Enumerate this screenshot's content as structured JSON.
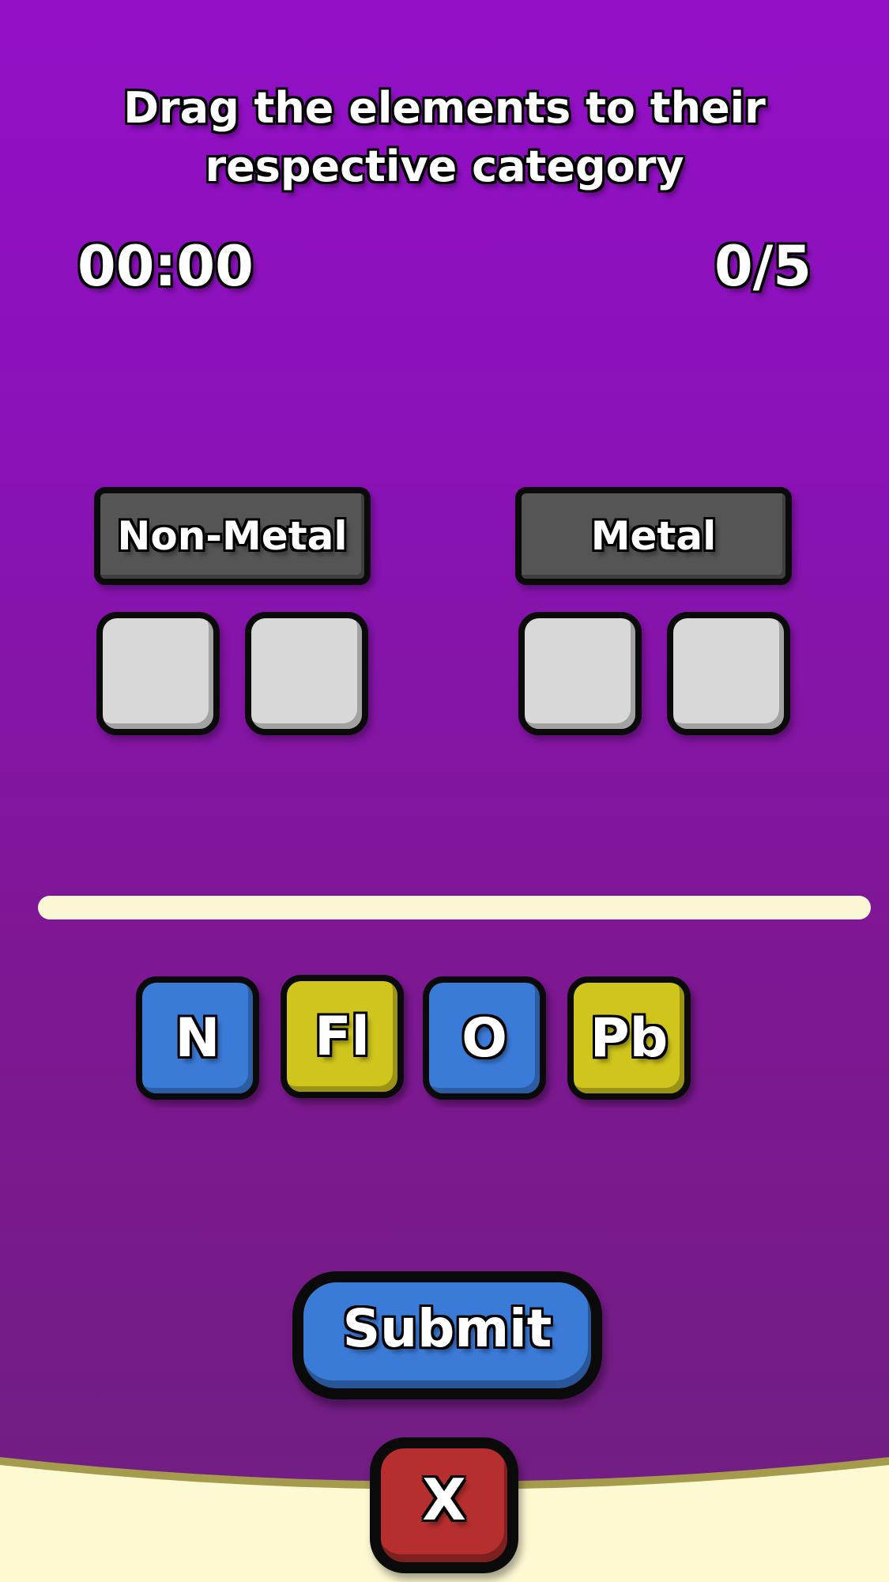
{
  "instructions": {
    "line1": "Drag the elements to their",
    "line2": "respective category"
  },
  "timer": "00:00",
  "score": "0/5",
  "categories": [
    {
      "label": "Non-Metal",
      "slots": 2
    },
    {
      "label": "Metal",
      "slots": 2
    }
  ],
  "element_tiles": [
    {
      "symbol": "N",
      "color": "#3b7bd8"
    },
    {
      "symbol": "Fl",
      "color": "#cfc51c"
    },
    {
      "symbol": "O",
      "color": "#3b7bd8"
    },
    {
      "symbol": "Pb",
      "color": "#cfc51c"
    }
  ],
  "submit_label": "Submit",
  "close_label": "X",
  "colors": {
    "background_top": "#920fc6",
    "background_bottom": "#701f80",
    "category_label_bg": "#555555",
    "slot_bg": "#d8d8d8",
    "divider": "#fbf6d4",
    "submit_bg": "#3b7bd8",
    "close_bg": "#b62e2e",
    "bottom_panel": "#fdf9d2"
  }
}
